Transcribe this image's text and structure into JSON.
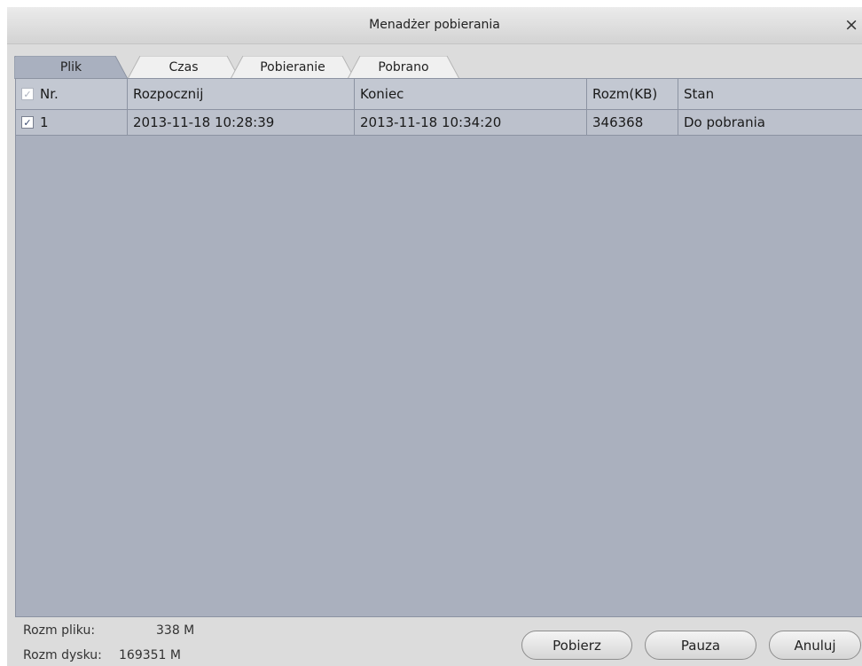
{
  "window": {
    "title": "Menadżer pobierania",
    "close_glyph": "×"
  },
  "tabs": [
    {
      "label": "Plik",
      "active": true
    },
    {
      "label": "Czas",
      "active": false
    },
    {
      "label": "Pobieranie",
      "active": false
    },
    {
      "label": "Pobrano",
      "active": false
    }
  ],
  "table": {
    "columns": [
      "Nr.",
      "Rozpocznij",
      "Koniec",
      "Rozm(KB)",
      "Stan"
    ],
    "rows": [
      {
        "checked": true,
        "nr": "1",
        "start": "2013-11-18 10:28:39",
        "end": "2013-11-18 10:34:20",
        "size_kb": "346368",
        "status": "Do pobrania"
      }
    ]
  },
  "footer": {
    "file_size_label": "Rozm pliku:",
    "file_size_value": "338 M",
    "disk_size_label": "Rozm dysku:",
    "disk_size_value": "169351 M"
  },
  "buttons": {
    "download": "Pobierz",
    "pause": "Pauza",
    "cancel": "Anuluj"
  },
  "icons": {
    "checkbox_check": "✓"
  },
  "colors": {
    "panel": "#aab0be",
    "header": "#c3c8d2",
    "row_selected": "#bcc1cc",
    "active_tab": "#a9b0bf"
  }
}
